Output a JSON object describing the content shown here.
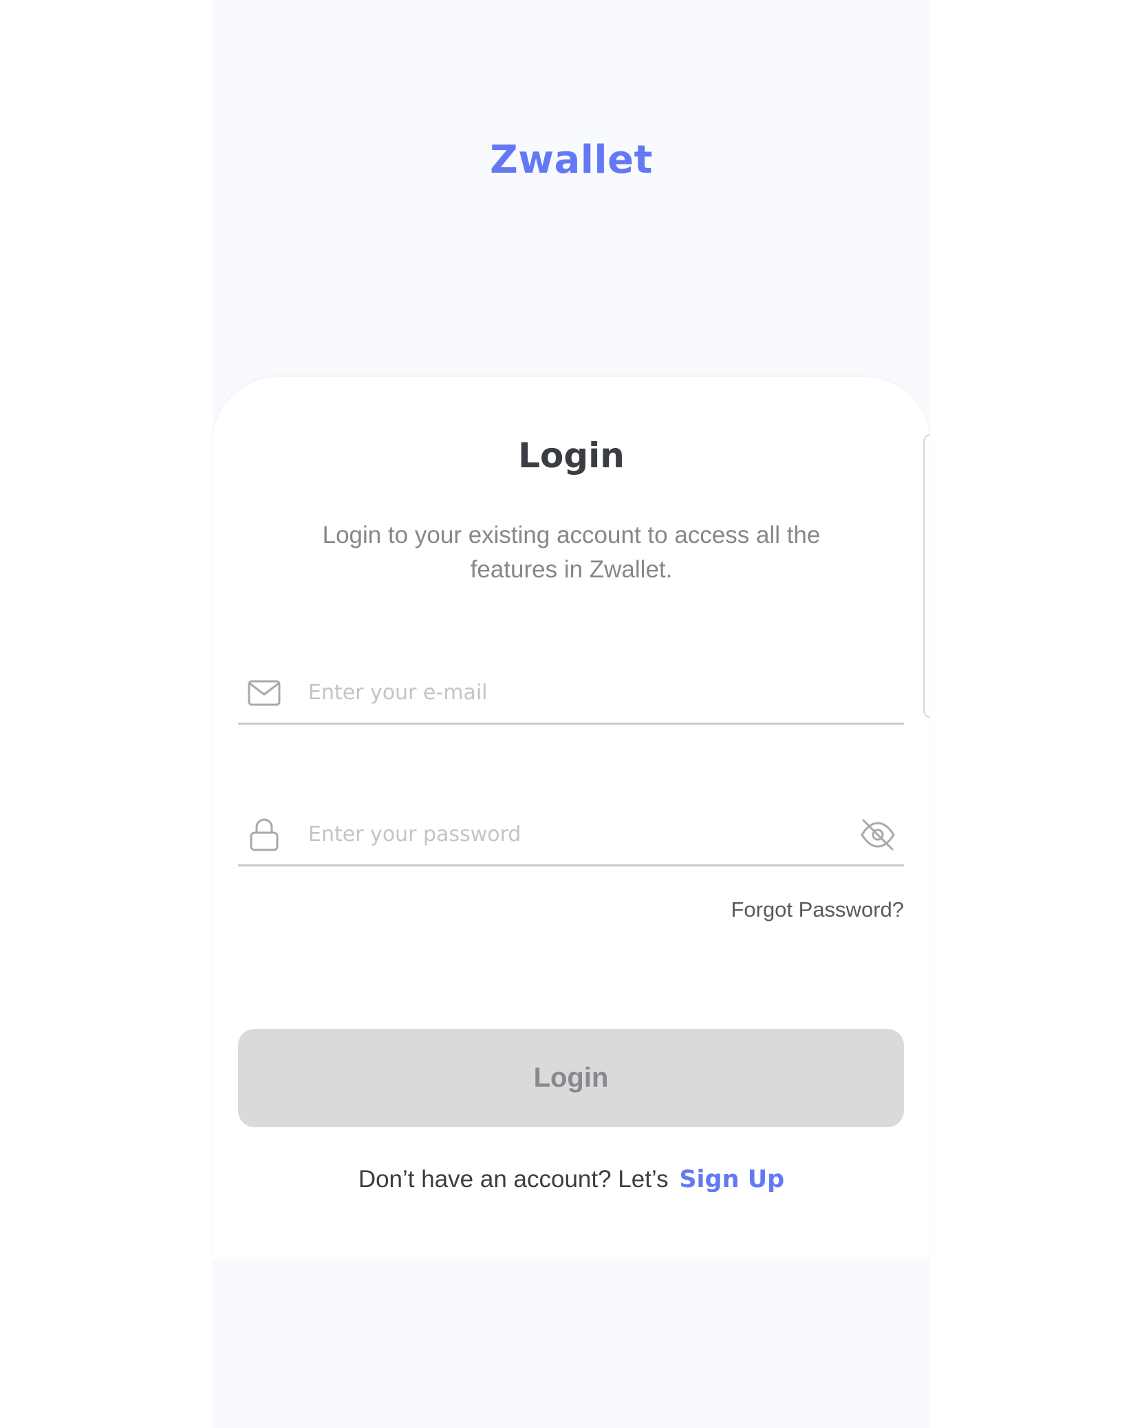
{
  "app": {
    "brand": "Zwallet",
    "accent_color": "#6379f4"
  },
  "login": {
    "title": "Login",
    "subtitle": "Login to your existing account to access all the features in Zwallet.",
    "email": {
      "icon": "mail-icon",
      "placeholder": "Enter your e-mail",
      "value": ""
    },
    "password": {
      "icon": "lock-icon",
      "placeholder": "Enter your password",
      "value": "",
      "toggle_icon": "eye-off-icon"
    },
    "forgot_password": "Forgot Password?",
    "submit_label": "Login",
    "signup_prompt": "Don’t have an account? Let’s",
    "signup_link": "Sign Up"
  }
}
